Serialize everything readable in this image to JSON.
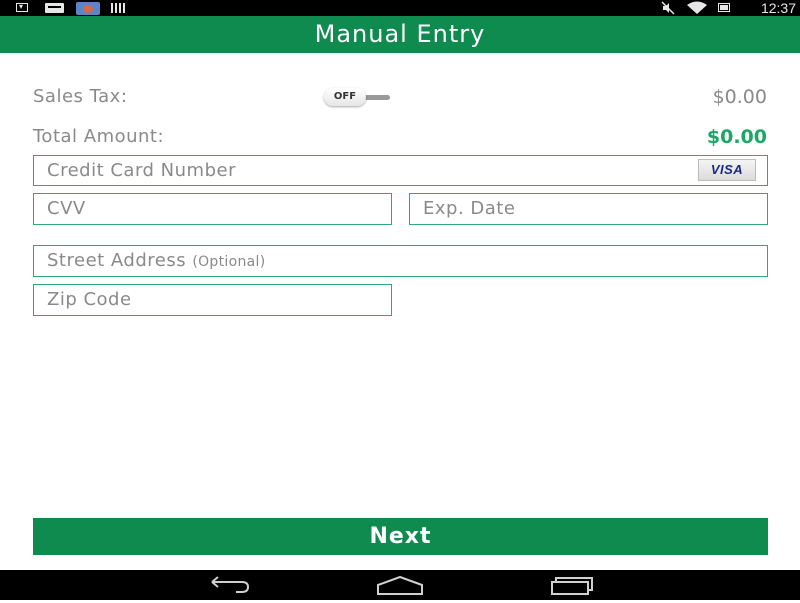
{
  "status_bar": {
    "time": "12:37",
    "left_icons": [
      "download-icon",
      "card-icon",
      "photo-icon",
      "barcode-icon"
    ],
    "right_icons": [
      "mute-icon",
      "wifi-icon",
      "battery-icon"
    ]
  },
  "header": {
    "title": "Manual Entry"
  },
  "sales_tax": {
    "label": "Sales Tax:",
    "toggle_label": "OFF",
    "value": "$0.00"
  },
  "total_amount": {
    "label": "Total Amount:",
    "value": "$0.00"
  },
  "form": {
    "card_number": {
      "placeholder": "Credit Card Number",
      "brand_logo": "VISA"
    },
    "cvv": {
      "placeholder": "CVV"
    },
    "exp_date": {
      "placeholder": "Exp. Date"
    },
    "street_address": {
      "placeholder": "Street Address",
      "optional_hint": "(Optional)"
    },
    "zip_code": {
      "placeholder": "Zip Code"
    }
  },
  "next_button": {
    "label": "Next"
  },
  "nav_bar": {
    "buttons": [
      "back-icon",
      "home-icon",
      "recents-icon"
    ]
  },
  "colors": {
    "primary_green": "#0f8b50",
    "total_green": "#1aa865",
    "field_border": "#2fa873",
    "muted_text": "#8a8a8a"
  }
}
